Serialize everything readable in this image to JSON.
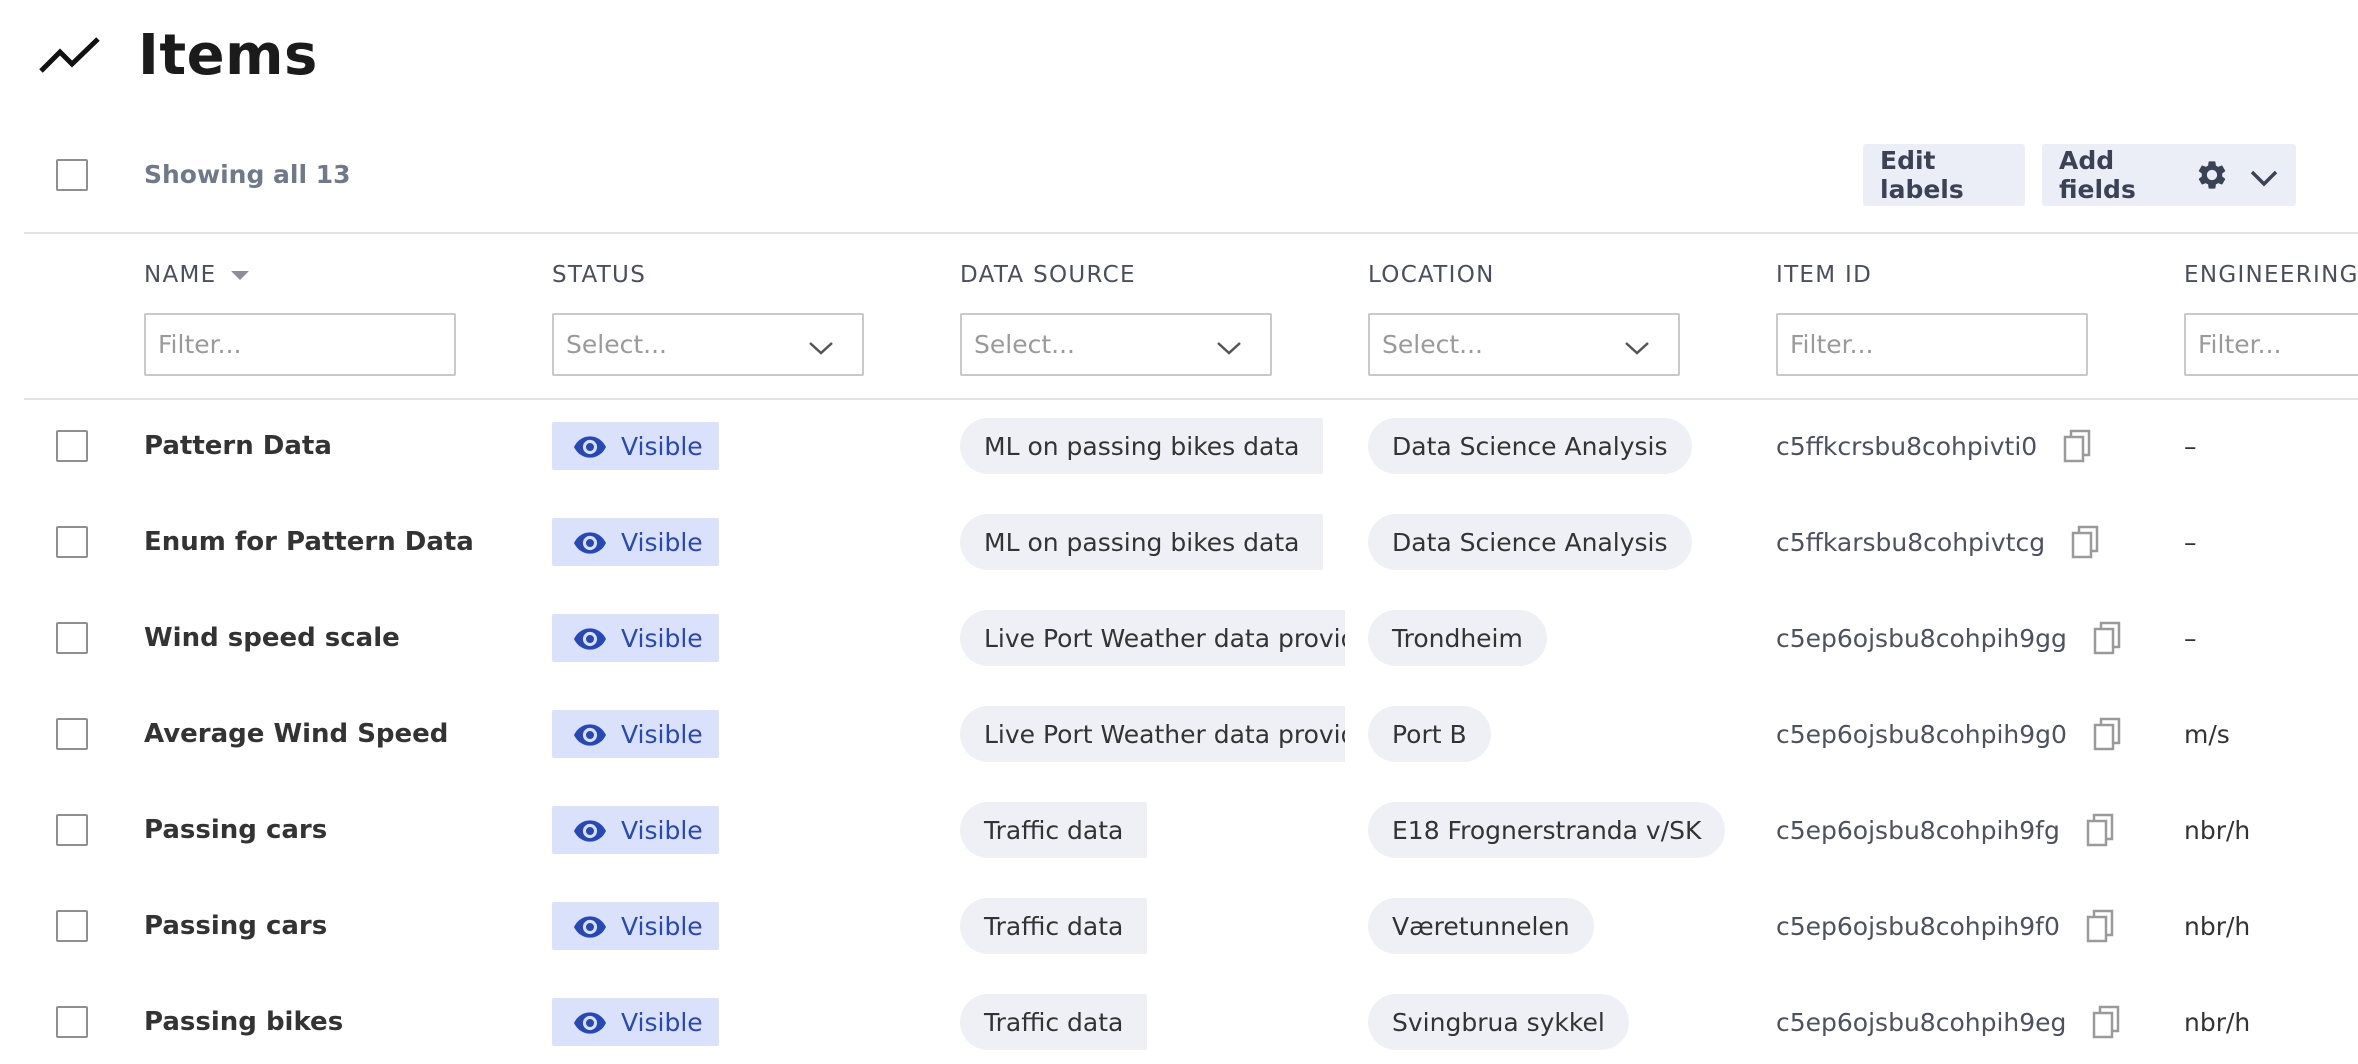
{
  "header": {
    "title": "Items",
    "icon": "trend-line-icon"
  },
  "toolbar": {
    "showing": "Showing all 13",
    "edit_labels": "Edit labels",
    "add_fields": "Add fields"
  },
  "columns": [
    {
      "label": "NAME",
      "placeholder": "Filter...",
      "kind": "filter",
      "sorted": "desc"
    },
    {
      "label": "STATUS",
      "placeholder": "Select...",
      "kind": "select"
    },
    {
      "label": "DATA SOURCE",
      "placeholder": "Select...",
      "kind": "select"
    },
    {
      "label": "LOCATION",
      "placeholder": "Select...",
      "kind": "select"
    },
    {
      "label": "ITEM ID",
      "placeholder": "Filter...",
      "kind": "filter"
    },
    {
      "label": "ENGINEERING U",
      "placeholder": "Filter...",
      "kind": "filter"
    }
  ],
  "rows": [
    {
      "name": "Pattern Data",
      "status": "Visible",
      "source": "ML on passing bikes data",
      "location": "Data Science Analysis",
      "item_id": "c5ffkcrsbu8cohpivti0",
      "unit": "–"
    },
    {
      "name": "Enum for Pattern Data",
      "status": "Visible",
      "source": "ML on passing bikes data",
      "location": "Data Science Analysis",
      "item_id": "c5ffkarsbu8cohpivtcg",
      "unit": "–"
    },
    {
      "name": "Wind speed scale",
      "status": "Visible",
      "source": "Live Port Weather data provide",
      "location": "Trondheim",
      "item_id": "c5ep6ojsbu8cohpih9gg",
      "unit": "–"
    },
    {
      "name": "Average Wind Speed",
      "status": "Visible",
      "source": "Live Port Weather data provide",
      "location": "Port B",
      "item_id": "c5ep6ojsbu8cohpih9g0",
      "unit": "m/s"
    },
    {
      "name": "Passing cars",
      "status": "Visible",
      "source": "Traffic data",
      "location": "E18 Frognerstranda v/SK",
      "item_id": "c5ep6ojsbu8cohpih9fg",
      "unit": "nbr/h"
    },
    {
      "name": "Passing cars",
      "status": "Visible",
      "source": "Traffic data",
      "location": "Væretunnelen",
      "item_id": "c5ep6ojsbu8cohpih9f0",
      "unit": "nbr/h"
    },
    {
      "name": "Passing bikes",
      "status": "Visible",
      "source": "Traffic data",
      "location": "Svingbrua sykkel",
      "item_id": "c5ep6ojsbu8cohpih9eg",
      "unit": "nbr/h"
    }
  ],
  "colors": {
    "accent": "#2948b8",
    "badge_bg": "#d9e1fb",
    "button_bg": "#eceef7",
    "pill_bg": "#eef0f5"
  }
}
